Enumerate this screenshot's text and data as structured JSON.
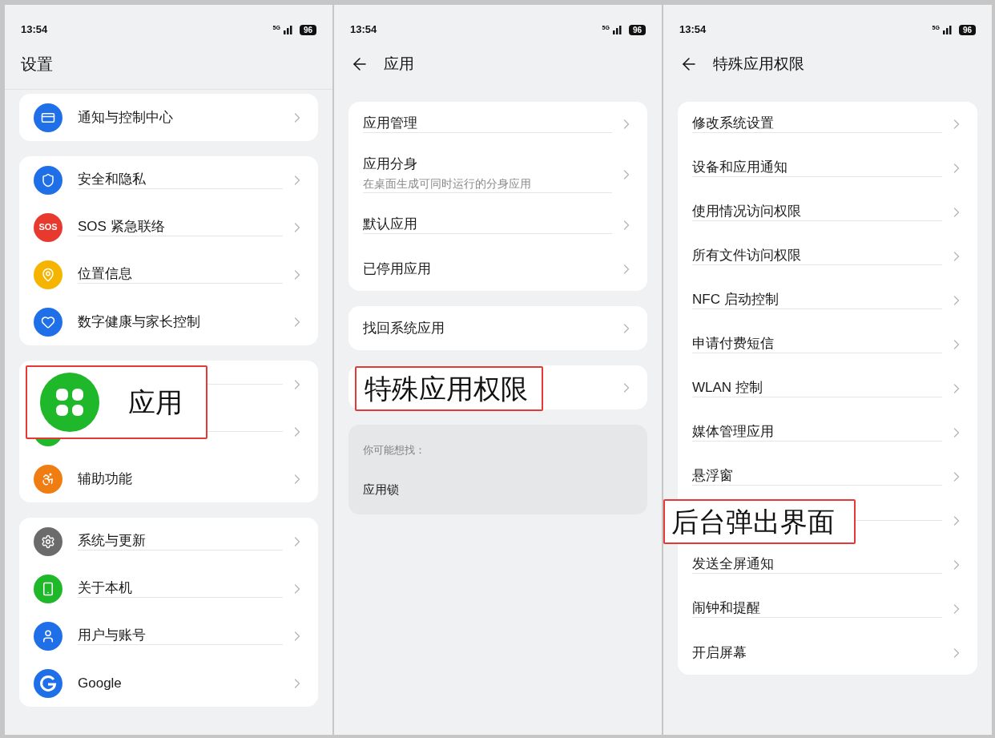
{
  "panels": [
    {
      "status_bar": {
        "time": "13:54",
        "network": "5G",
        "battery": "96"
      },
      "header": {
        "title": "设置",
        "back": false
      },
      "groups": [
        {
          "kind": "card",
          "items": [
            {
              "kind": "notification",
              "label": "通知与控制中心",
              "highlighted": false
            }
          ]
        },
        {
          "kind": "card",
          "items": [
            {
              "kind": "shield",
              "label": "安全和隐私",
              "highlighted": false
            },
            {
              "kind": "emergency",
              "badge": "SOS",
              "label": "SOS 紧急联络",
              "highlighted": false
            },
            {
              "kind": "location",
              "label": "位置信息",
              "highlighted": false
            },
            {
              "kind": "wellbeing",
              "label": "数字健康与家长控制",
              "highlighted": false
            }
          ]
        },
        {
          "kind": "card",
          "items": [
            {
              "kind": "apps",
              "label": "应用",
              "highlighted": true
            },
            {
              "kind": "battery",
              "highlighted": false
            },
            {
              "kind": "accessibility",
              "label": "辅助功能",
              "highlighted": false
            }
          ]
        },
        {
          "kind": "card",
          "items": [
            {
              "kind": "gear",
              "label": "系统与更新",
              "highlighted": false
            },
            {
              "kind": "phone",
              "label": "关于本机",
              "highlighted": false
            },
            {
              "kind": "user",
              "label": "用户与账号",
              "highlighted": false
            },
            {
              "kind": "google",
              "label": "Google",
              "highlighted": false
            }
          ]
        }
      ]
    },
    {
      "status_bar": {
        "time": "13:54",
        "network": "5G",
        "battery": "96"
      },
      "header": {
        "title": "应用",
        "back": true
      },
      "groups": [
        {
          "kind": "card",
          "items": [
            {
              "label": "应用管理",
              "highlighted": false
            },
            {
              "label": "应用分身",
              "subtitle": "在桌面生成可同时运行的分身应用",
              "highlighted": false
            },
            {
              "label": "默认应用",
              "highlighted": false
            },
            {
              "label": "已停用应用",
              "highlighted": false
            }
          ]
        },
        {
          "kind": "card",
          "items": [
            {
              "label": "找回系统应用",
              "highlighted": false
            }
          ]
        },
        {
          "kind": "card",
          "items": [
            {
              "label": "特殊应用权限",
              "highlighted": true
            }
          ]
        },
        {
          "kind": "suggestions",
          "heading": "你可能想找：",
          "items": [
            {
              "label": "应用锁",
              "highlighted": false
            }
          ]
        }
      ]
    },
    {
      "status_bar": {
        "time": "13:54",
        "network": "5G",
        "battery": "96"
      },
      "header": {
        "title": "特殊应用权限",
        "back": true
      },
      "groups": [
        {
          "kind": "card",
          "items": [
            {
              "label": "修改系统设置",
              "highlighted": false
            },
            {
              "label": "设备和应用通知",
              "highlighted": false
            },
            {
              "label": "使用情况访问权限",
              "highlighted": false
            },
            {
              "label": "所有文件访问权限",
              "highlighted": false
            },
            {
              "label": "NFC 启动控制",
              "highlighted": false
            },
            {
              "label": "申请付费短信",
              "highlighted": false
            },
            {
              "label": "WLAN 控制",
              "highlighted": false
            },
            {
              "label": "媒体管理应用",
              "highlighted": false
            },
            {
              "label": "悬浮窗",
              "highlighted": false
            },
            {
              "label": "后台弹出界面",
              "highlighted": true
            },
            {
              "label": "发送全屏通知",
              "highlighted": false
            },
            {
              "label": "闹钟和提醒",
              "highlighted": false
            },
            {
              "label": "开启屏幕",
              "highlighted": false
            }
          ]
        }
      ]
    }
  ]
}
